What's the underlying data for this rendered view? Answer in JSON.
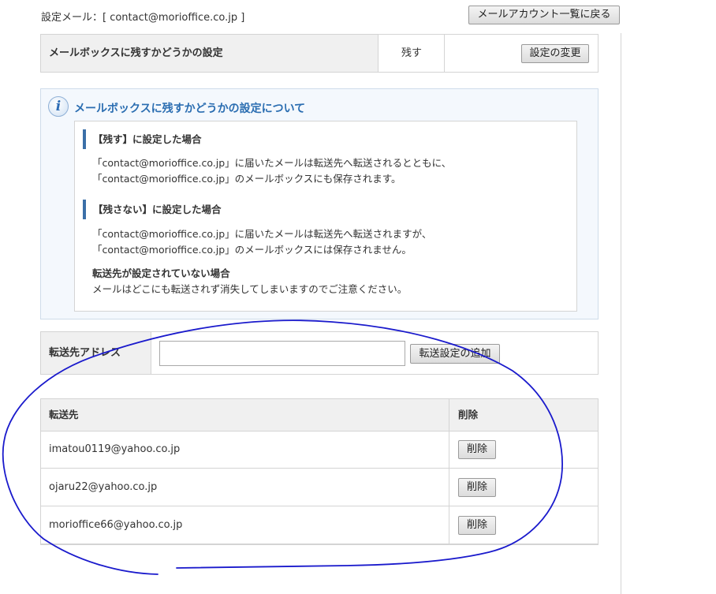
{
  "header": {
    "setting_mail": "設定メール：[ contact@morioffice.co.jp ]",
    "back_button": "メールアカウント一覧に戻る"
  },
  "mailbox_setting": {
    "label": "メールボックスに残すかどうかの設定",
    "value": "残す",
    "change_button": "設定の変更"
  },
  "info": {
    "icon": "info-icon",
    "icon_glyph": "i",
    "title": "メールボックスに残すかどうかの設定について",
    "keep_heading": "【残す】に設定した場合",
    "keep_line1": "「contact@morioffice.co.jp」に届いたメールは転送先へ転送されるとともに、",
    "keep_line2": "「contact@morioffice.co.jp」のメールボックスにも保存されます。",
    "nokeep_heading": "【残さない】に設定した場合",
    "nokeep_line1": "「contact@morioffice.co.jp」に届いたメールは転送先へ転送されますが、",
    "nokeep_line2": "「contact@morioffice.co.jp」のメールボックスには保存されません。",
    "none_heading": "転送先が設定されていない場合",
    "none_line": "メールはどこにも転送されず消失してしまいますのでご注意ください。"
  },
  "forward_form": {
    "label": "転送先アドレス",
    "input_value": "",
    "add_button": "転送設定の追加"
  },
  "forward_list": {
    "col_destination": "転送先",
    "col_delete": "削除",
    "rows": [
      {
        "email": "imatou0119@yahoo.co.jp",
        "delete_label": "削除"
      },
      {
        "email": "ojaru22@yahoo.co.jp",
        "delete_label": "削除"
      },
      {
        "email": "morioffice66@yahoo.co.jp",
        "delete_label": "削除"
      }
    ]
  },
  "colors": {
    "info_title": "#2a6db1",
    "annotation_stroke": "#1a1acc",
    "table_header_bg": "#f0f0f0"
  }
}
